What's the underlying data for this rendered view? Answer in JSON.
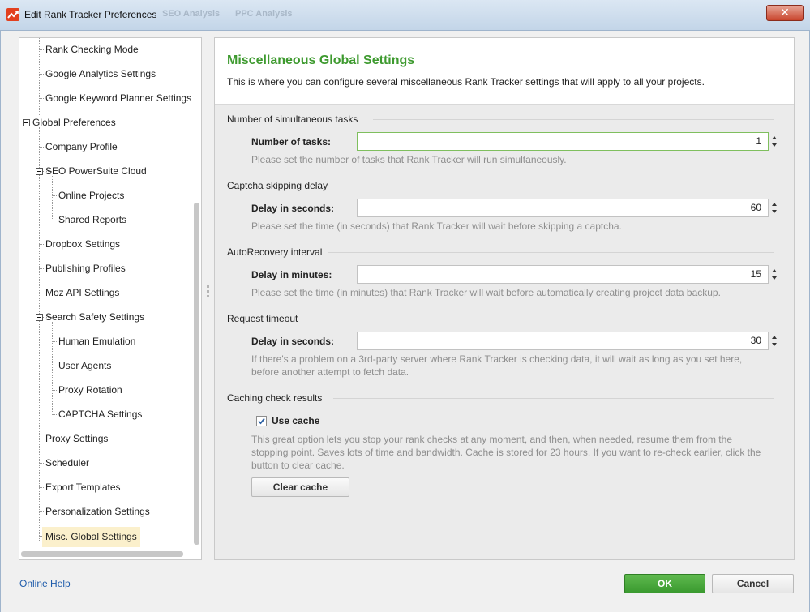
{
  "window": {
    "title": "Edit Rank Tracker Preferences",
    "ghost_tabs": [
      "SEO Analysis",
      "PPC Analysis"
    ],
    "close_glyph": "✕",
    "accent_color": "#3e9a2f",
    "app_icon": "rank-tracker-icon"
  },
  "tree": {
    "items": [
      {
        "label": "Rank Checking Mode"
      },
      {
        "label": "Google Analytics Settings"
      },
      {
        "label": "Google Keyword Planner Settings"
      },
      {
        "label": "Global Preferences"
      },
      {
        "label": "Company Profile"
      },
      {
        "label": "SEO PowerSuite Cloud"
      },
      {
        "label": "Online Projects"
      },
      {
        "label": "Shared Reports"
      },
      {
        "label": "Dropbox Settings"
      },
      {
        "label": "Publishing Profiles"
      },
      {
        "label": "Moz API Settings"
      },
      {
        "label": "Search Safety Settings"
      },
      {
        "label": "Human Emulation"
      },
      {
        "label": "User Agents"
      },
      {
        "label": "Proxy Rotation"
      },
      {
        "label": "CAPTCHA Settings"
      },
      {
        "label": "Proxy Settings"
      },
      {
        "label": "Scheduler"
      },
      {
        "label": "Export Templates"
      },
      {
        "label": "Personalization Settings"
      },
      {
        "label": "Misc. Global Settings"
      }
    ],
    "selected": "Misc. Global Settings"
  },
  "content": {
    "title": "Miscellaneous Global Settings",
    "subtitle": "This is where you can configure several miscellaneous Rank Tracker settings that will apply to all your projects.",
    "sections": [
      {
        "title": "Number of simultaneous tasks",
        "label": "Number of tasks:",
        "value": "1",
        "help": "Please set the number of tasks that Rank Tracker will run simultaneously."
      },
      {
        "title": "Captcha skipping delay",
        "label": "Delay in seconds:",
        "value": "60",
        "help": "Please set the time (in seconds) that Rank Tracker will wait before skipping a captcha."
      },
      {
        "title": "AutoRecovery interval",
        "label": "Delay in minutes:",
        "value": "15",
        "help": "Please set the time (in minutes) that Rank Tracker will wait before automatically creating project data backup."
      },
      {
        "title": "Request timeout",
        "label": "Delay in seconds:",
        "value": "30",
        "help": "If there's a problem on a 3rd-party server where Rank Tracker is checking data, it will wait as long as you set here, before another attempt to fetch data."
      }
    ],
    "caching": {
      "title": "Caching check results",
      "checkbox_label": "Use cache",
      "checked": true,
      "help": "This great option lets you stop your rank checks at any moment, and then, when needed, resume them from the stopping point. Saves lots of time and bandwidth. Cache is stored for 23 hours. If you want to re-check earlier, click the button to clear cache.",
      "button_label": "Clear cache"
    }
  },
  "footer": {
    "help_link": "Online Help",
    "ok_label": "OK",
    "cancel_label": "Cancel"
  }
}
